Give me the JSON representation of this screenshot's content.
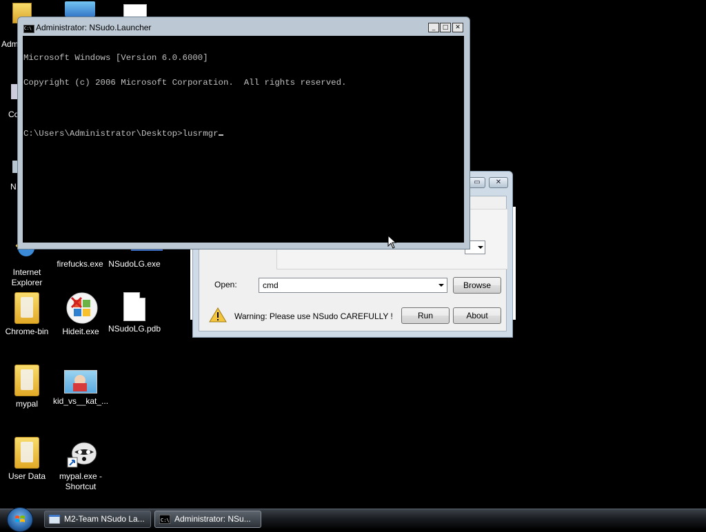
{
  "desktop": {
    "partial_labels": {
      "admin": "Adm",
      "computer": "Co",
      "network": "N"
    },
    "icons": [
      {
        "label": "Internet Explorer"
      },
      {
        "label": "firefucks.exe"
      },
      {
        "label": "NSudoLG.exe"
      },
      {
        "label": "Chrome-bin"
      },
      {
        "label": "Hideit.exe"
      },
      {
        "label": "NSudoLG.pdb"
      },
      {
        "label": "mypal"
      },
      {
        "label": "kid_vs__kat_..."
      },
      {
        "label": "User Data"
      },
      {
        "label": "mypal.exe - Shortcut"
      }
    ]
  },
  "cmd_window": {
    "title": "Administrator: NSudo.Launcher",
    "minimize": "_",
    "maximize": "□",
    "close": "✕",
    "lines": [
      "Microsoft Windows [Version 6.0.6000]",
      "Copyright (c) 2006 Microsoft Corporation.  All rights reserved.",
      "",
      "C:\\Users\\Administrator\\Desktop>lusrmgr"
    ]
  },
  "run_dialog": {
    "open_label": "Open:",
    "open_value": "cmd",
    "browse": "Browse",
    "warning": "Warning: Please use NSudo CAREFULLY !",
    "run": "Run",
    "about": "About",
    "restore_glyph": "▭",
    "close_glyph": "✕"
  },
  "taskbar": {
    "buttons": [
      {
        "label": "M2-Team NSudo La..."
      },
      {
        "label": "Administrator: NSu..."
      }
    ]
  },
  "colors": {
    "console_bg": "#000000",
    "console_text": "#c0c0c0",
    "desktop_bg": "#000000",
    "taskbar": "#1a1d21"
  }
}
